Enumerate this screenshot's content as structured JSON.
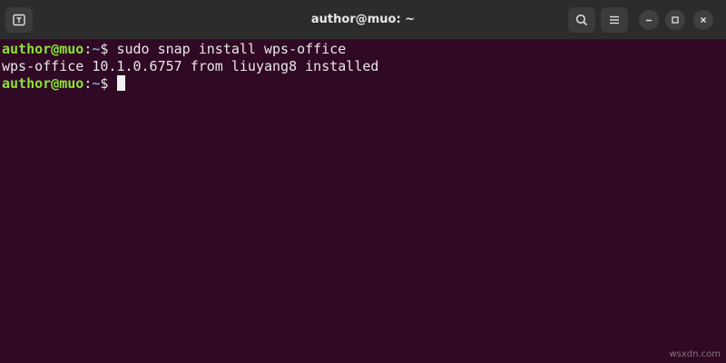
{
  "window": {
    "title": "author@muo: ~"
  },
  "terminal": {
    "lines": [
      {
        "user_host": "author@muo",
        "sep": ":",
        "path": "~",
        "prompt": "$ ",
        "command": "sudo snap install wps-office"
      },
      {
        "output": "wps-office 10.1.0.6757 from liuyang8 installed"
      },
      {
        "user_host": "author@muo",
        "sep": ":",
        "path": "~",
        "prompt": "$ ",
        "command": ""
      }
    ]
  },
  "icons": {
    "new_tab": "new-tab-icon",
    "search": "search-icon",
    "menu": "hamburger-menu-icon",
    "minimize": "minimize-icon",
    "maximize": "maximize-icon",
    "close": "close-icon"
  },
  "colors": {
    "terminal_bg": "#300a24",
    "titlebar_bg": "#2c2c2c",
    "prompt_user": "#8ae234",
    "prompt_path": "#729fcf",
    "text": "#e7e7e7"
  },
  "watermark": "wsxdn.com"
}
